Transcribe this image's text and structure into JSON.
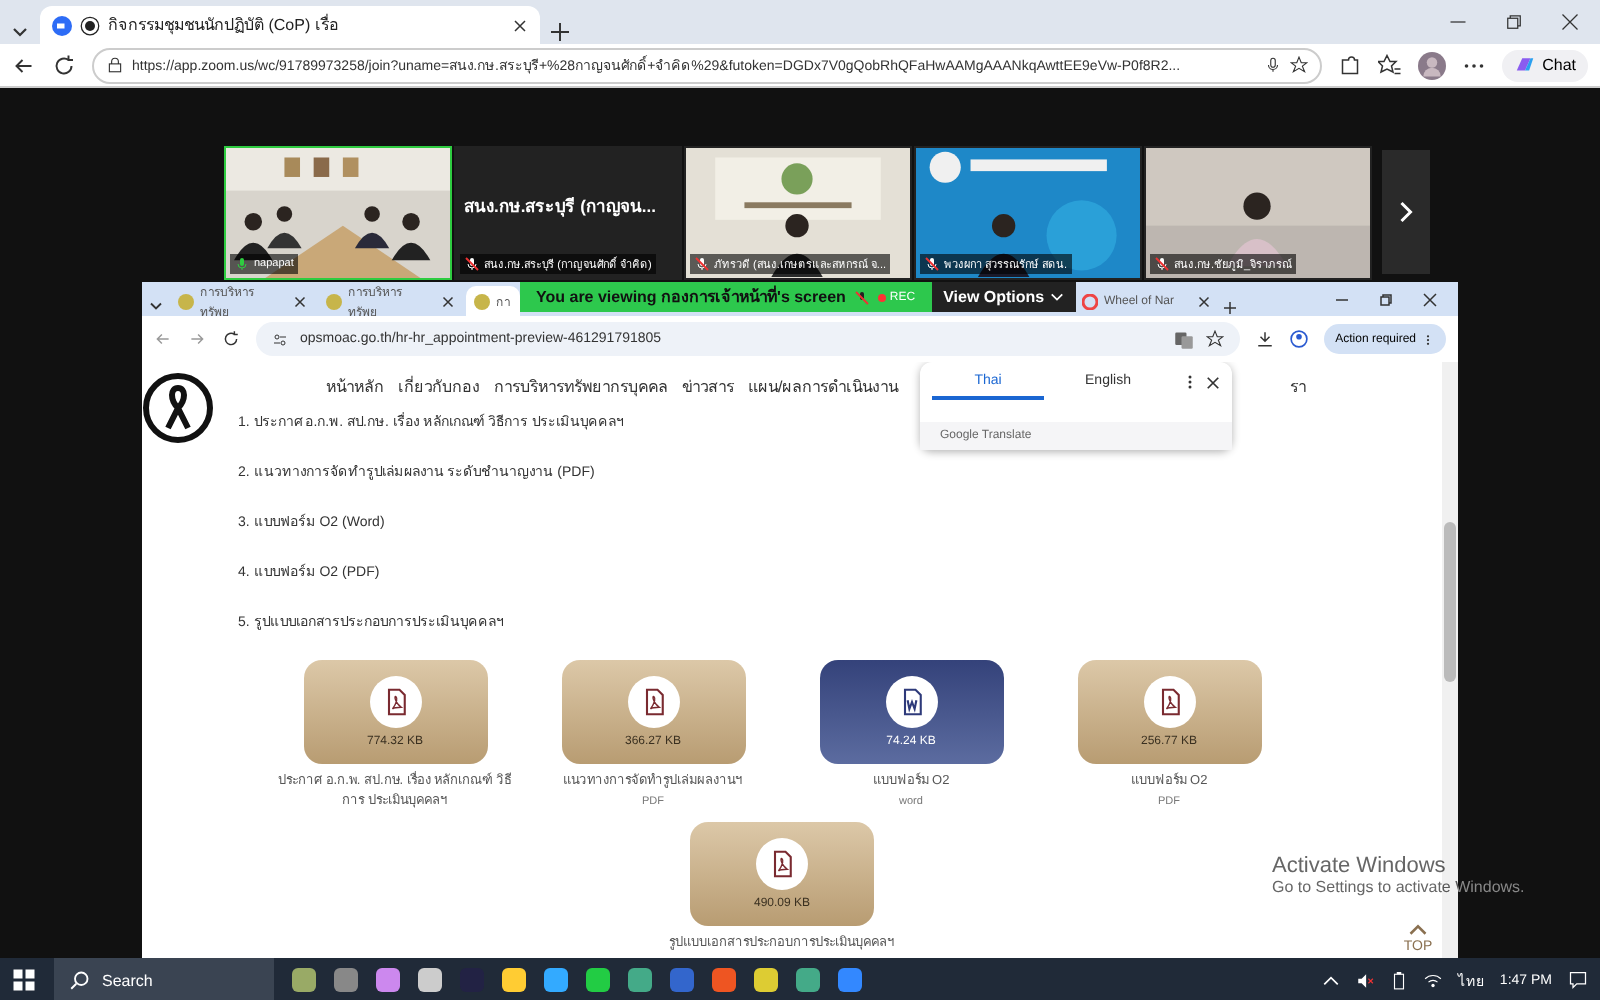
{
  "browser": {
    "tab": {
      "title": "กิจกรรมชุมชนนักปฏิบัติ (CoP) เรื่อ",
      "selected": true
    },
    "url": "https://app.zoom.us/wc/91789973258/join?uname=สนง.กษ.สระบุรี+%28กาญจนศักดิ์+จำคิด%29&futoken=DGDx7V0gQobRhQFaHwAAMgAAANkqAwttEE9eVw-P0f8R2...",
    "chat": "Chat"
  },
  "meeting": {
    "participants": [
      {
        "kind": "room",
        "name": "napapat",
        "muted": false,
        "selected": true
      },
      {
        "kind": "name_only",
        "title": "สนง.กษ.สระบุรี (กาญจน...",
        "name": "สนง.กษ.สระบุรี (กาญจนศักดิ์ จำคิด)",
        "muted": true,
        "selected": false
      },
      {
        "kind": "office",
        "name": "ภัทรวดี (สนง.เกษตรและสหกรณ์ จ...",
        "muted": true,
        "selected": false
      },
      {
        "kind": "banner",
        "name": "พวงผกา สุวรรณรักษ์ สดน.",
        "muted": true,
        "selected": false
      },
      {
        "kind": "plain",
        "name": "สนง.กษ.ชัยภูมิ_จิราภรณ์",
        "muted": true,
        "selected": false
      }
    ],
    "share_banner": {
      "text": "You are viewing กองการเจ้าหน้าที่'s screen",
      "rec": "REC",
      "view_options": "View Options"
    }
  },
  "shared_browser": {
    "tabs": [
      {
        "title": "การบริหารทรัพย",
        "selected": false
      },
      {
        "title": "การบริหารทรัพย",
        "selected": false
      },
      {
        "title": "กา",
        "selected": true
      },
      {
        "title": "Wheel of Nar",
        "selected": false
      }
    ],
    "url": "opsmoac.go.th/hr-hr_appointment-preview-461291791805",
    "action_required": "Action required",
    "nav": [
      "หน้าหลัก",
      "เกี่ยวกับกอง",
      "การบริหารทรัพยากรบุคคล",
      "ข่าวสาร",
      "แผน/ผลการดำเนินงาน",
      "รา"
    ],
    "translate": {
      "languages": [
        {
          "label": "Thai",
          "selected": true
        },
        {
          "label": "English",
          "selected": false
        }
      ],
      "footer": "Google Translate"
    },
    "list": [
      "1. ประกาศ อ.ก.พ. สป.กษ. เรื่อง หลักเกณฑ์ วิธีการ ประเมินบุคคลฯ",
      "2. แนวทางการจัดทำรูปเล่มผลงาน ระดับชำนาญงาน (PDF)",
      "3. แบบฟอร์ม O2 (Word)",
      "4. แบบฟอร์ม O2 (PDF)",
      "5. รูปแบบเอกสารประกอบการประเมินบุคคลฯ"
    ],
    "files": [
      {
        "kind": "pdf",
        "size": "774.32 KB",
        "title": "ประกาศ อ.ก.พ. สป.กษ. เรื่อง หลักเกณฑ์ วิธีการ ประเมินบุคคลฯ"
      },
      {
        "kind": "pdf",
        "size": "366.27 KB",
        "title": "แนวทางการจัดทำรูปเล่มผลงานฯ",
        "subtitle": "PDF"
      },
      {
        "kind": "word",
        "size": "74.24 KB",
        "title": "แบบฟอร์ม O2",
        "subtitle": "word"
      },
      {
        "kind": "pdf",
        "size": "256.77 KB",
        "title": "แบบฟอร์ม O2",
        "subtitle": "PDF"
      },
      {
        "kind": "pdf",
        "size": "490.09 KB",
        "title": "รูปแบบเอกสารประกอบการประเมินบุคคลฯ"
      }
    ],
    "top_button": "TOP"
  },
  "activation_notice": {
    "title": "Activate Windows",
    "text": "Go to Settings to activate Windows."
  },
  "taskbar": {
    "search": "Search",
    "language": "ไทย",
    "time": "1:47 PM"
  }
}
